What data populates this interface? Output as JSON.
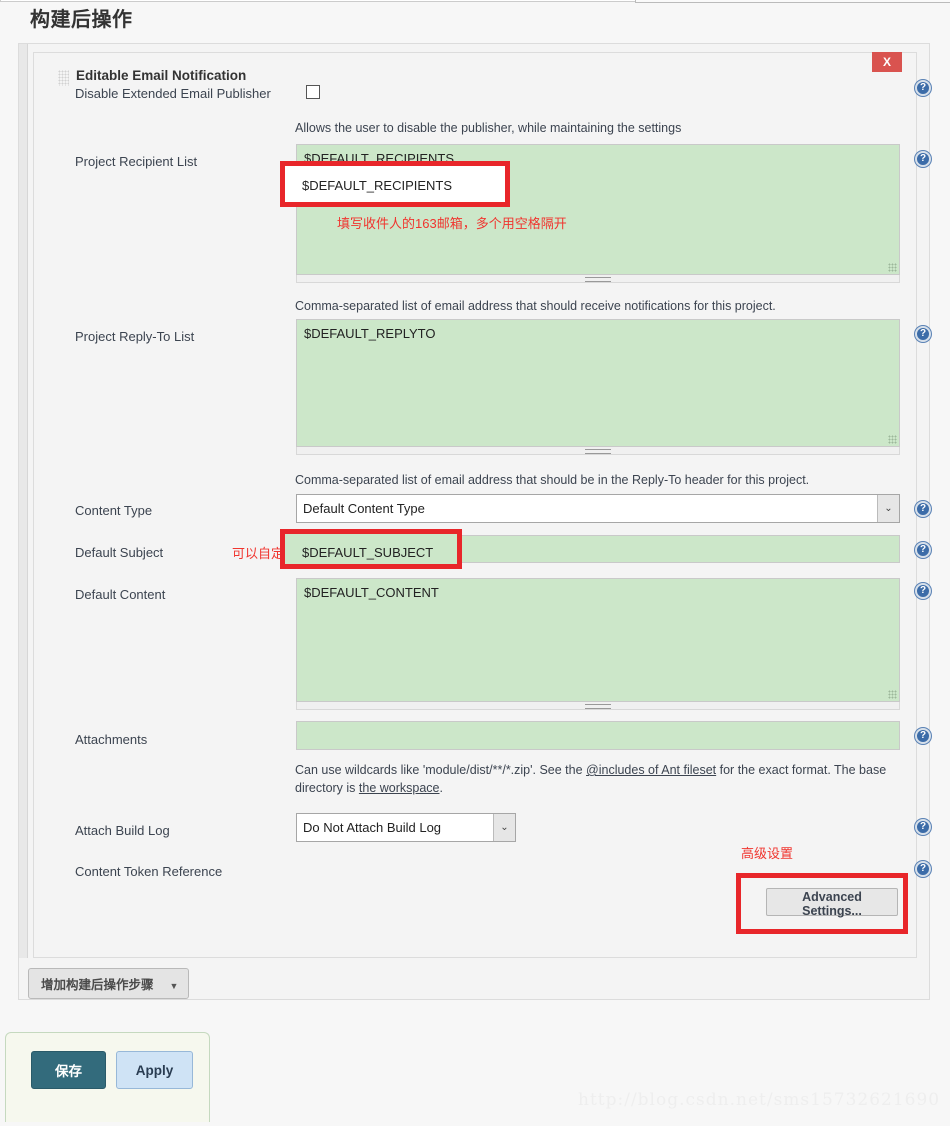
{
  "page": {
    "title": "构建后操作",
    "watermark": "http://blog.csdn.net/sms15732621690"
  },
  "panel": {
    "title": "Editable Email Notification",
    "close_label": "X",
    "grip_icon": "drag-grip-icon",
    "help_icon": "help-icon",
    "help_glyph": "?"
  },
  "fields": {
    "disable_publisher": {
      "label": "Disable Extended Email Publisher",
      "checked": false,
      "help": "Allows the user to disable the publisher, while maintaining the settings"
    },
    "project_recipient_list": {
      "label": "Project Recipient List",
      "value": "$DEFAULT_RECIPIENTS",
      "help": "Comma-separated list of email address that should receive notifications for this project.",
      "annotation": "填写收件人的163邮箱，多个用空格隔开"
    },
    "project_reply_to_list": {
      "label": "Project Reply-To List",
      "value": "$DEFAULT_REPLYTO",
      "help": "Comma-separated list of email address that should be in the Reply-To header for this project."
    },
    "content_type": {
      "label": "Content Type",
      "value": "Default Content Type",
      "options": [
        "Default Content Type"
      ]
    },
    "default_subject": {
      "label": "Default Subject",
      "value": "$DEFAULT_SUBJECT",
      "annotation": "可以自定义标题"
    },
    "default_content": {
      "label": "Default Content",
      "value": "$DEFAULT_CONTENT"
    },
    "attachments": {
      "label": "Attachments",
      "value": "",
      "help_prefix": "Can use wildcards like 'module/dist/**/*.zip'. See the ",
      "help_link1": "@includes of Ant fileset",
      "help_mid": " for the exact format. The base directory is ",
      "help_link2": "the workspace",
      "help_suffix": "."
    },
    "attach_build_log": {
      "label": "Attach Build Log",
      "value": "Do Not Attach Build Log",
      "options": [
        "Do Not Attach Build Log"
      ]
    },
    "content_token_reference": {
      "label": "Content Token Reference"
    },
    "advanced_settings": {
      "label": "Advanced Settings...",
      "annotation": "高级设置"
    }
  },
  "footer": {
    "add_step_label": "增加构建后操作步骤",
    "add_step_caret": "▼",
    "save_label": "保存",
    "apply_label": "Apply"
  },
  "colors": {
    "field_green": "#cce7c9",
    "annotation_red": "#e8262a",
    "save_teal": "#336b7c",
    "apply_blue": "#cfe3f5",
    "close_red": "#d9534f",
    "help_blue": "#3c6ca8"
  }
}
